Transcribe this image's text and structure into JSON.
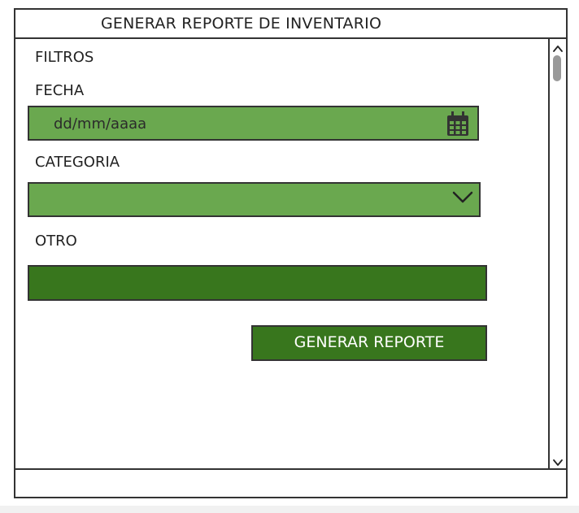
{
  "window": {
    "title": "GENERAR REPORTE DE INVENTARIO"
  },
  "filters": {
    "section_label": "FILTROS",
    "date_label": "FECHA",
    "date_placeholder": "dd/mm/aaaa",
    "category_label": "CATEGORIA",
    "category_value": "",
    "other_label": "OTRO",
    "other_value": ""
  },
  "actions": {
    "generate_label": "GENERAR REPORTE"
  },
  "icons": {
    "date": "calendar-icon",
    "category": "chevron-down-icon",
    "scroll_up": "chevron-up-icon",
    "scroll_down": "chevron-down-icon"
  },
  "colors": {
    "light_green": "#6aa84f",
    "dark_green": "#38761d",
    "border": "#333333"
  }
}
